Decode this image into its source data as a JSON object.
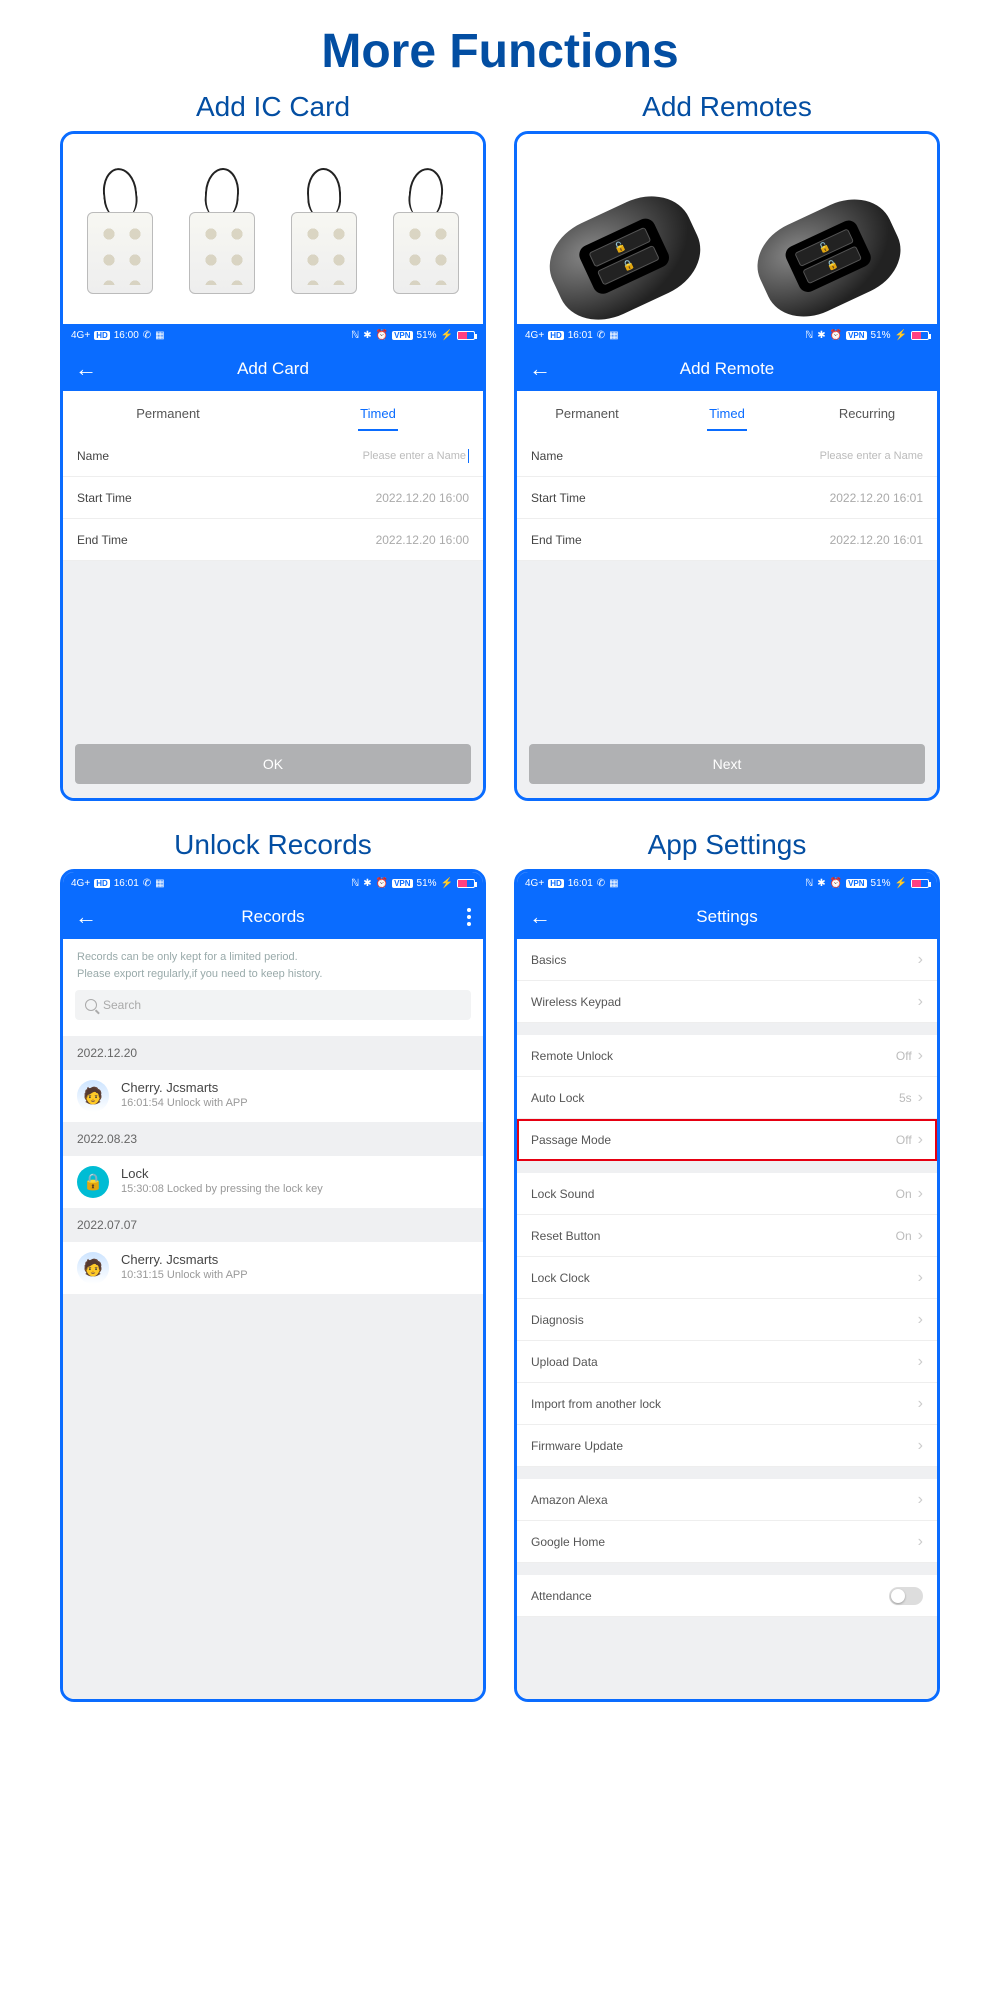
{
  "page_title": "More Functions",
  "sections": {
    "ic": "Add IC Card",
    "remote": "Add Remotes",
    "records": "Unlock Records",
    "settings": "App Settings"
  },
  "status": {
    "time_ic": "16:00",
    "time_remote": "16:01",
    "time_records": "16:01",
    "time_settings": "16:01",
    "signal": "4G+",
    "hd": "HD",
    "vpn": "VPN",
    "batt": "51%"
  },
  "ic_panel": {
    "header": "Add Card",
    "tabs": [
      "Permanent",
      "Timed"
    ],
    "active_tab": 1,
    "name_label": "Name",
    "name_placeholder": "Please enter a Name",
    "start_label": "Start Time",
    "start_value": "2022.12.20 16:00",
    "end_label": "End Time",
    "end_value": "2022.12.20 16:00",
    "ok": "OK"
  },
  "remote_panel": {
    "header": "Add Remote",
    "tabs": [
      "Permanent",
      "Timed",
      "Recurring"
    ],
    "active_tab": 1,
    "name_label": "Name",
    "name_placeholder": "Please enter a Name",
    "start_label": "Start Time",
    "start_value": "2022.12.20 16:01",
    "end_label": "End Time",
    "end_value": "2022.12.20 16:01",
    "next": "Next"
  },
  "records": {
    "header": "Records",
    "note1": "Records can be only kept for a limited period.",
    "note2": "Please export regularly,if you need to keep history.",
    "search": "Search",
    "groups": [
      {
        "date": "2022.12.20",
        "items": [
          {
            "avatar": "user",
            "name": "Cherry. Jcsmarts",
            "detail": "16:01:54 Unlock with APP"
          }
        ]
      },
      {
        "date": "2022.08.23",
        "items": [
          {
            "avatar": "lock",
            "name": "Lock",
            "detail": "15:30:08 Locked by pressing the lock key"
          }
        ]
      },
      {
        "date": "2022.07.07",
        "items": [
          {
            "avatar": "user",
            "name": "Cherry. Jcsmarts",
            "detail": "10:31:15 Unlock with APP"
          }
        ]
      }
    ]
  },
  "settings": {
    "header": "Settings",
    "rows": [
      {
        "label": "Basics",
        "value": ""
      },
      {
        "label": "Wireless Keypad",
        "value": ""
      },
      {
        "gap": true
      },
      {
        "label": "Remote Unlock",
        "value": "Off"
      },
      {
        "label": "Auto Lock",
        "value": "5s"
      },
      {
        "label": "Passage Mode",
        "value": "Off",
        "highlight": true
      },
      {
        "gap": true
      },
      {
        "label": "Lock Sound",
        "value": "On"
      },
      {
        "label": "Reset Button",
        "value": "On"
      },
      {
        "label": "Lock Clock",
        "value": ""
      },
      {
        "label": "Diagnosis",
        "value": ""
      },
      {
        "label": "Upload Data",
        "value": ""
      },
      {
        "label": "Import from another lock",
        "value": ""
      },
      {
        "label": "Firmware Update",
        "value": ""
      },
      {
        "gap": true
      },
      {
        "label": "Amazon Alexa",
        "value": ""
      },
      {
        "label": "Google Home",
        "value": ""
      },
      {
        "gap": true
      },
      {
        "label": "Attendance",
        "value": "",
        "toggle": true
      }
    ]
  }
}
